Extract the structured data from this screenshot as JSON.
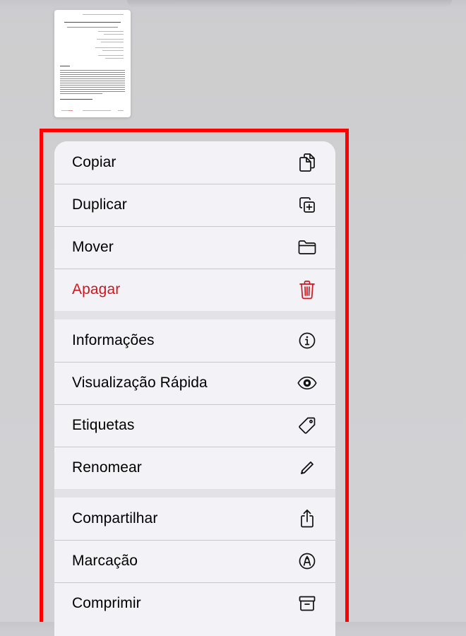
{
  "colors": {
    "destructive": "#d0161e",
    "label": "#000000",
    "menu_background": "#f2f2f7",
    "highlight": "#ff0000"
  },
  "menu": {
    "groups": [
      {
        "items": [
          {
            "label": "Copiar",
            "icon": "copy-icon"
          },
          {
            "label": "Duplicar",
            "icon": "duplicate-icon"
          },
          {
            "label": "Mover",
            "icon": "folder-icon"
          },
          {
            "label": "Apagar",
            "icon": "trash-icon",
            "destructive": true
          }
        ]
      },
      {
        "items": [
          {
            "label": "Informações",
            "icon": "info-icon"
          },
          {
            "label": "Visualização Rápida",
            "icon": "eye-icon"
          },
          {
            "label": "Etiquetas",
            "icon": "tag-icon"
          },
          {
            "label": "Renomear",
            "icon": "pencil-icon"
          }
        ]
      },
      {
        "items": [
          {
            "label": "Compartilhar",
            "icon": "share-icon"
          },
          {
            "label": "Marcação",
            "icon": "markup-icon"
          },
          {
            "label": "Comprimir",
            "icon": "archive-icon"
          }
        ]
      }
    ]
  }
}
